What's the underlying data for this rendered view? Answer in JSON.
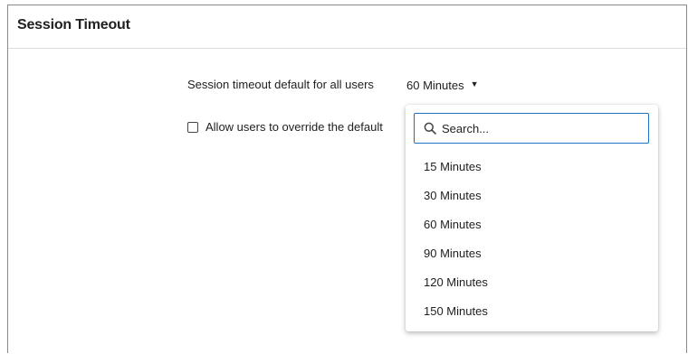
{
  "panel": {
    "title": "Session Timeout"
  },
  "timeout_setting": {
    "label": "Session timeout default for all users",
    "selected_value": "60 Minutes"
  },
  "override": {
    "label": "Allow users to override the default",
    "checked": false
  },
  "dropdown": {
    "search_placeholder": "Search...",
    "options": [
      {
        "label": "15 Minutes"
      },
      {
        "label": "30 Minutes"
      },
      {
        "label": "60 Minutes"
      },
      {
        "label": "90 Minutes"
      },
      {
        "label": "120 Minutes"
      },
      {
        "label": "150 Minutes"
      }
    ]
  },
  "colors": {
    "search_border": "#1a73c4",
    "panel_border": "#8a8a8a",
    "text": "#212121"
  },
  "icons": {
    "caret": "caret-down-icon",
    "search": "search-icon"
  }
}
